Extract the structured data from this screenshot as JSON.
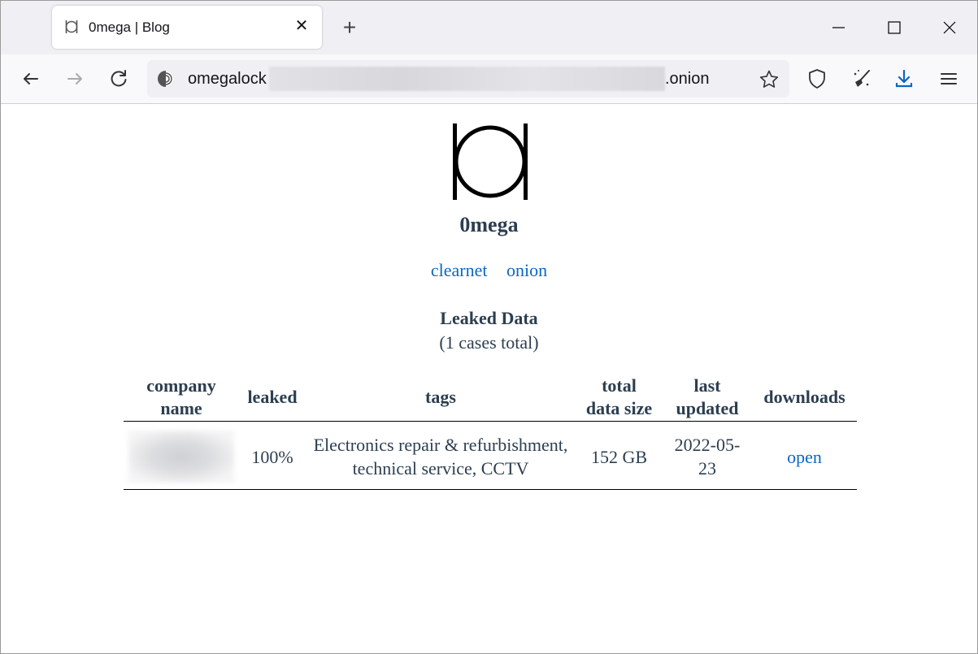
{
  "browser": {
    "tab": {
      "title": "0mega | Blog",
      "favicon": "omega-logo-icon"
    },
    "new_tab_label": "+",
    "url": {
      "visible_prefix": "omegalock",
      "visible_suffix": ".onion",
      "redacted": true
    },
    "window_controls": [
      "minimize",
      "maximize",
      "close"
    ],
    "toolbar_icons": [
      "back-icon",
      "forward-icon",
      "reload-icon",
      "tor-onion-icon",
      "bookmark-star-icon",
      "shield-icon",
      "broom-icon",
      "download-icon",
      "menu-icon"
    ],
    "accent_color": "#0b66c3"
  },
  "page": {
    "site_name": "0mega",
    "links": [
      {
        "label": "clearnet"
      },
      {
        "label": "onion"
      }
    ],
    "section_title": "Leaked Data",
    "section_subtitle": "(1 cases total)",
    "table": {
      "headers": [
        {
          "line1": "company",
          "line2": "name"
        },
        {
          "line1": "leaked",
          "line2": ""
        },
        {
          "line1": "tags",
          "line2": ""
        },
        {
          "line1": "total",
          "line2": "data size"
        },
        {
          "line1": "last",
          "line2": "updated"
        },
        {
          "line1": "downloads",
          "line2": ""
        }
      ],
      "rows": [
        {
          "company_name": "[redacted]",
          "leaked": "100%",
          "tags": "Electronics repair & refurbishment, technical service, CCTV",
          "total_data_size": "152 GB",
          "last_updated": "2022-05-23",
          "download_label": "open"
        }
      ]
    },
    "text_color": "#2c3e50",
    "link_color": "#0b66c3"
  }
}
